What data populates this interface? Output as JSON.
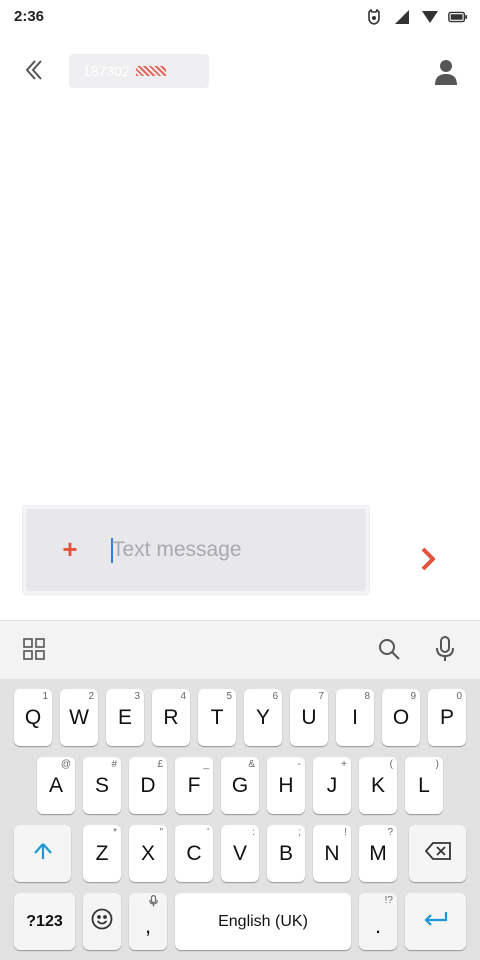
{
  "status_bar": {
    "time": "2:36",
    "icons": [
      "guard-icon",
      "signal-icon",
      "wifi-icon",
      "battery-icon"
    ]
  },
  "header": {
    "back_icon": "double-chevron-left-icon",
    "recipient_text": "187302",
    "contact_icon": "person-icon"
  },
  "composer": {
    "placeholder": "Text message",
    "value": "",
    "attach_symbol": "+",
    "send_icon": "chevron-right-icon",
    "accent_color": "#e5533d"
  },
  "keyboard_toolbar": {
    "icons": [
      "apps-grid-icon",
      "search-icon",
      "microphone-icon"
    ]
  },
  "keyboard": {
    "row1": [
      {
        "label": "Q",
        "hint": "1"
      },
      {
        "label": "W",
        "hint": "2"
      },
      {
        "label": "E",
        "hint": "3"
      },
      {
        "label": "R",
        "hint": "4"
      },
      {
        "label": "T",
        "hint": "5"
      },
      {
        "label": "Y",
        "hint": "6"
      },
      {
        "label": "U",
        "hint": "7"
      },
      {
        "label": "I",
        "hint": "8"
      },
      {
        "label": "O",
        "hint": "9"
      },
      {
        "label": "P",
        "hint": "0"
      }
    ],
    "row2": [
      {
        "label": "A",
        "hint": "@"
      },
      {
        "label": "S",
        "hint": "#"
      },
      {
        "label": "D",
        "hint": "£"
      },
      {
        "label": "F",
        "hint": "_"
      },
      {
        "label": "G",
        "hint": "&"
      },
      {
        "label": "H",
        "hint": "-"
      },
      {
        "label": "J",
        "hint": "+"
      },
      {
        "label": "K",
        "hint": "("
      },
      {
        "label": "L",
        "hint": ")"
      }
    ],
    "row3": [
      {
        "label": "Z",
        "hint": "*"
      },
      {
        "label": "X",
        "hint": "\""
      },
      {
        "label": "C",
        "hint": "'"
      },
      {
        "label": "V",
        "hint": ":"
      },
      {
        "label": "B",
        "hint": ";"
      },
      {
        "label": "N",
        "hint": "!"
      },
      {
        "label": "M",
        "hint": "?"
      }
    ],
    "symbols_label": "?123",
    "comma_label": ",",
    "space_label": "English (UK)",
    "period_label": ".",
    "period_hint": "!?",
    "accent_color": "#2196d6"
  }
}
